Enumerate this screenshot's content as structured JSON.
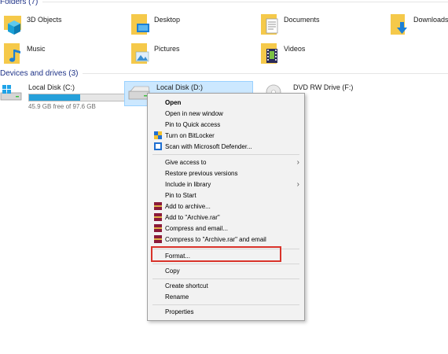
{
  "folders_header": "Folders (7)",
  "drives_header": "Devices and drives (3)",
  "folders": [
    {
      "label": "3D Objects",
      "icon": "3d-objects-folder-icon"
    },
    {
      "label": "Desktop",
      "icon": "desktop-folder-icon"
    },
    {
      "label": "Documents",
      "icon": "documents-folder-icon"
    },
    {
      "label": "Downloads",
      "icon": "downloads-folder-icon"
    },
    {
      "label": "Music",
      "icon": "music-folder-icon"
    },
    {
      "label": "Pictures",
      "icon": "pictures-folder-icon"
    },
    {
      "label": "Videos",
      "icon": "videos-folder-icon"
    }
  ],
  "drives": [
    {
      "name": "Local Disk (C:)",
      "free": "45.9 GB free of 97.6 GB",
      "used_fraction": 0.53
    },
    {
      "name": "Local Disk (D:)",
      "selected": true
    },
    {
      "name": "DVD RW Drive (F:)"
    }
  ],
  "context_menu": {
    "open": "Open",
    "open_new_window": "Open in new window",
    "pin_quick_access": "Pin to Quick access",
    "turn_on_bitlocker": "Turn on BitLocker",
    "scan_defender": "Scan with Microsoft Defender...",
    "give_access": "Give access to",
    "restore_versions": "Restore previous versions",
    "include_library": "Include in library",
    "pin_start": "Pin to Start",
    "add_archive": "Add to archive...",
    "add_archive_rar": "Add to \"Archive.rar\"",
    "compress_email": "Compress and email...",
    "compress_rar_email": "Compress to \"Archive.rar\" and email",
    "format": "Format...",
    "copy": "Copy",
    "create_shortcut": "Create shortcut",
    "rename": "Rename",
    "properties": "Properties",
    "submenu_arrow": "›"
  },
  "colors": {
    "selection_bg": "#cce8ff",
    "bar_fill": "#26a0da",
    "highlight_border": "#d9332a",
    "header_text": "#1e3287"
  }
}
